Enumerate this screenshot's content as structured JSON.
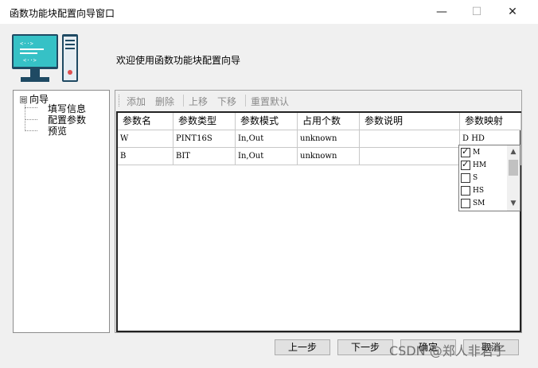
{
  "window": {
    "title": "函数功能块配置向导窗口",
    "minimize_glyph": "—",
    "maximize_glyph": "☐",
    "close_glyph": "✕"
  },
  "welcome_text": "欢迎使用函数功能块配置向导",
  "tree": {
    "expander_glyph": "⊟",
    "root": "向导",
    "children": [
      "填写信息",
      "配置参数",
      "预览"
    ]
  },
  "toolbar": {
    "add": "添加",
    "delete": "删除",
    "move_up": "上移",
    "move_down": "下移",
    "reset_default": "重置默认"
  },
  "table": {
    "headers": [
      "参数名",
      "参数类型",
      "参数模式",
      "占用个数",
      "参数说明",
      "参数映射"
    ],
    "rows": [
      [
        "W",
        "PINT16S",
        "In,Out",
        "unknown",
        "",
        "D HD"
      ],
      [
        "B",
        "BIT",
        "In,Out",
        "unknown",
        "",
        ""
      ]
    ]
  },
  "mapping_dropdown": {
    "options": [
      {
        "label": "M",
        "checked": true
      },
      {
        "label": "HM",
        "checked": true
      },
      {
        "label": "S",
        "checked": false
      },
      {
        "label": "HS",
        "checked": false
      },
      {
        "label": "SM",
        "checked": false
      }
    ],
    "scroll_up_glyph": "▲",
    "scroll_down_glyph": "▼"
  },
  "buttons": {
    "prev": "上一步",
    "next": "下一步",
    "ok": "确定",
    "cancel": "取消"
  },
  "watermark": "CSDN @郑人非君子",
  "colors": {
    "client_bg": "#f0f0f0",
    "monitor_teal": "#36c1c6",
    "toolbar_disabled": "#8a8a8a"
  }
}
